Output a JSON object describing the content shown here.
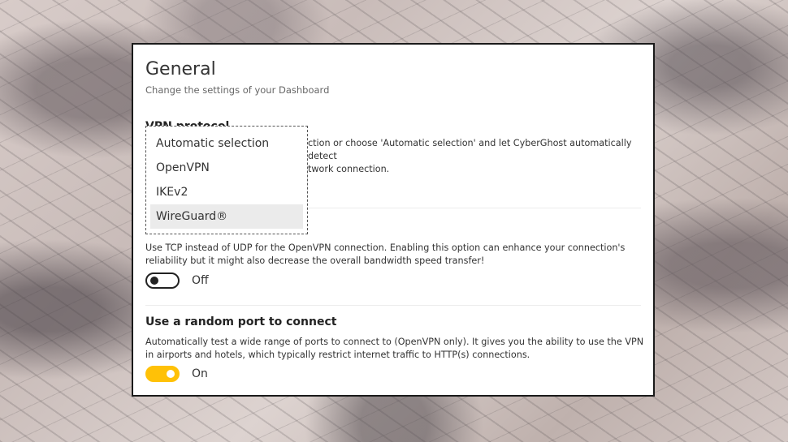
{
  "header": {
    "title": "General",
    "subtitle": "Change the settings of your Dashboard"
  },
  "vpn_protocol": {
    "title": "VPN protocol",
    "description_line1": "ction or choose 'Automatic selection' and let CyberGhost automatically detect",
    "description_line2": "twork connection.",
    "options": [
      "Automatic selection",
      "OpenVPN",
      "IKEv2",
      "WireGuard®"
    ],
    "selected": "WireGuard®"
  },
  "tcp": {
    "description": "Use TCP instead of UDP for the OpenVPN connection. Enabling this option can enhance your connection's reliability but it might also decrease the overall bandwidth speed transfer!",
    "toggle_state": "Off"
  },
  "random_port": {
    "title": "Use a random port to connect",
    "description": "Automatically test a wide range of ports to connect to (OpenVPN only). It gives you the ability to use the VPN in airports and hotels, which typically restrict internet traffic to HTTP(s) connections.",
    "toggle_state": "On"
  },
  "colors": {
    "accent": "#ffc107",
    "panel_bg": "#ffffff",
    "text": "#333333"
  }
}
